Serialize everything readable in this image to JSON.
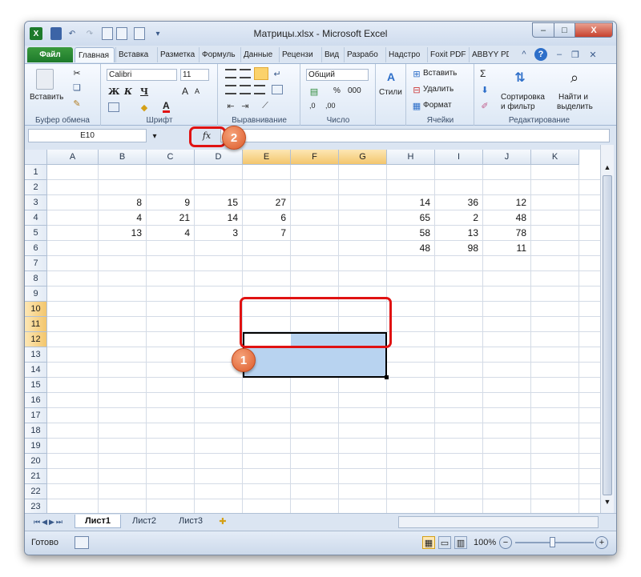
{
  "title": "Матрицы.xlsx - Microsoft Excel",
  "window_buttons": {
    "minimize": "–",
    "maximize": "□",
    "close": "X"
  },
  "tabs": [
    {
      "label": "Файл"
    },
    {
      "label": "Главная"
    },
    {
      "label": "Вставка"
    },
    {
      "label": "Разметка"
    },
    {
      "label": "Формуль"
    },
    {
      "label": "Данные"
    },
    {
      "label": "Рецензи"
    },
    {
      "label": "Вид"
    },
    {
      "label": "Разрабо"
    },
    {
      "label": "Надстро"
    },
    {
      "label": "Foxit PDF"
    },
    {
      "label": "ABBYY PD"
    }
  ],
  "ribbon": {
    "clipboard": {
      "paste": "Вставить",
      "group": "Буфер обмена"
    },
    "font": {
      "name": "Calibri",
      "size": "11",
      "bold": "Ж",
      "italic": "К",
      "underline": "Ч",
      "grow": "A",
      "shrink": "A",
      "color_a": "A",
      "group": "Шрифт"
    },
    "alignment": {
      "group": "Выравнивание"
    },
    "number": {
      "format": "Общий",
      "percent": "%",
      "thousands": "000",
      "inc": ",0",
      "dec": ",00",
      "group": "Число"
    },
    "styles": {
      "label": "Стили"
    },
    "cells": {
      "insert": "Вставить",
      "delete": "Удалить",
      "format": "Формат",
      "group": "Ячейки"
    },
    "editing": {
      "sum": "Σ",
      "sort": "Сортировка",
      "sort2": "и фильтр",
      "find": "Найти и",
      "find2": "выделить",
      "group": "Редактирование"
    }
  },
  "formula_bar": {
    "name_box": "E10",
    "fx": "fx",
    "formula": ""
  },
  "columns": [
    "A",
    "B",
    "C",
    "D",
    "E",
    "F",
    "G",
    "H",
    "I",
    "J",
    "K"
  ],
  "selected_columns": [
    "E",
    "F",
    "G"
  ],
  "rows": [
    "1",
    "2",
    "3",
    "4",
    "5",
    "6",
    "7",
    "8",
    "9",
    "10",
    "11",
    "12",
    "13",
    "14",
    "15",
    "16",
    "17",
    "18",
    "19",
    "20",
    "21",
    "22",
    "23"
  ],
  "selected_rows": [
    "10",
    "11",
    "12"
  ],
  "cells": [
    {
      "ref": "B3",
      "value": "8"
    },
    {
      "ref": "C3",
      "value": "9"
    },
    {
      "ref": "D3",
      "value": "15"
    },
    {
      "ref": "E3",
      "value": "27"
    },
    {
      "ref": "B4",
      "value": "4"
    },
    {
      "ref": "C4",
      "value": "21"
    },
    {
      "ref": "D4",
      "value": "14"
    },
    {
      "ref": "E4",
      "value": "6"
    },
    {
      "ref": "B5",
      "value": "13"
    },
    {
      "ref": "C5",
      "value": "4"
    },
    {
      "ref": "D5",
      "value": "3"
    },
    {
      "ref": "E5",
      "value": "7"
    },
    {
      "ref": "H3",
      "value": "14"
    },
    {
      "ref": "I3",
      "value": "36"
    },
    {
      "ref": "J3",
      "value": "12"
    },
    {
      "ref": "H4",
      "value": "65"
    },
    {
      "ref": "I4",
      "value": "2"
    },
    {
      "ref": "J4",
      "value": "48"
    },
    {
      "ref": "H5",
      "value": "58"
    },
    {
      "ref": "I5",
      "value": "13"
    },
    {
      "ref": "J5",
      "value": "78"
    },
    {
      "ref": "H6",
      "value": "48"
    },
    {
      "ref": "I6",
      "value": "98"
    },
    {
      "ref": "J6",
      "value": "11"
    }
  ],
  "selection": "E10:G12",
  "sheets": [
    {
      "label": "Лист1",
      "active": true
    },
    {
      "label": "Лист2"
    },
    {
      "label": "Лист3"
    }
  ],
  "status": {
    "ready": "Готово",
    "zoom": "100%",
    "zoom_out": "−",
    "zoom_in": "+"
  },
  "annotations": [
    {
      "label": "1"
    },
    {
      "label": "2"
    }
  ],
  "colors": {
    "selection_fill": "#b8d3f0",
    "header_selected": "#f3c66d",
    "annotation_red": "#e01212",
    "badge": "#dc5a2a",
    "file_tab": "#1d7a2b"
  }
}
